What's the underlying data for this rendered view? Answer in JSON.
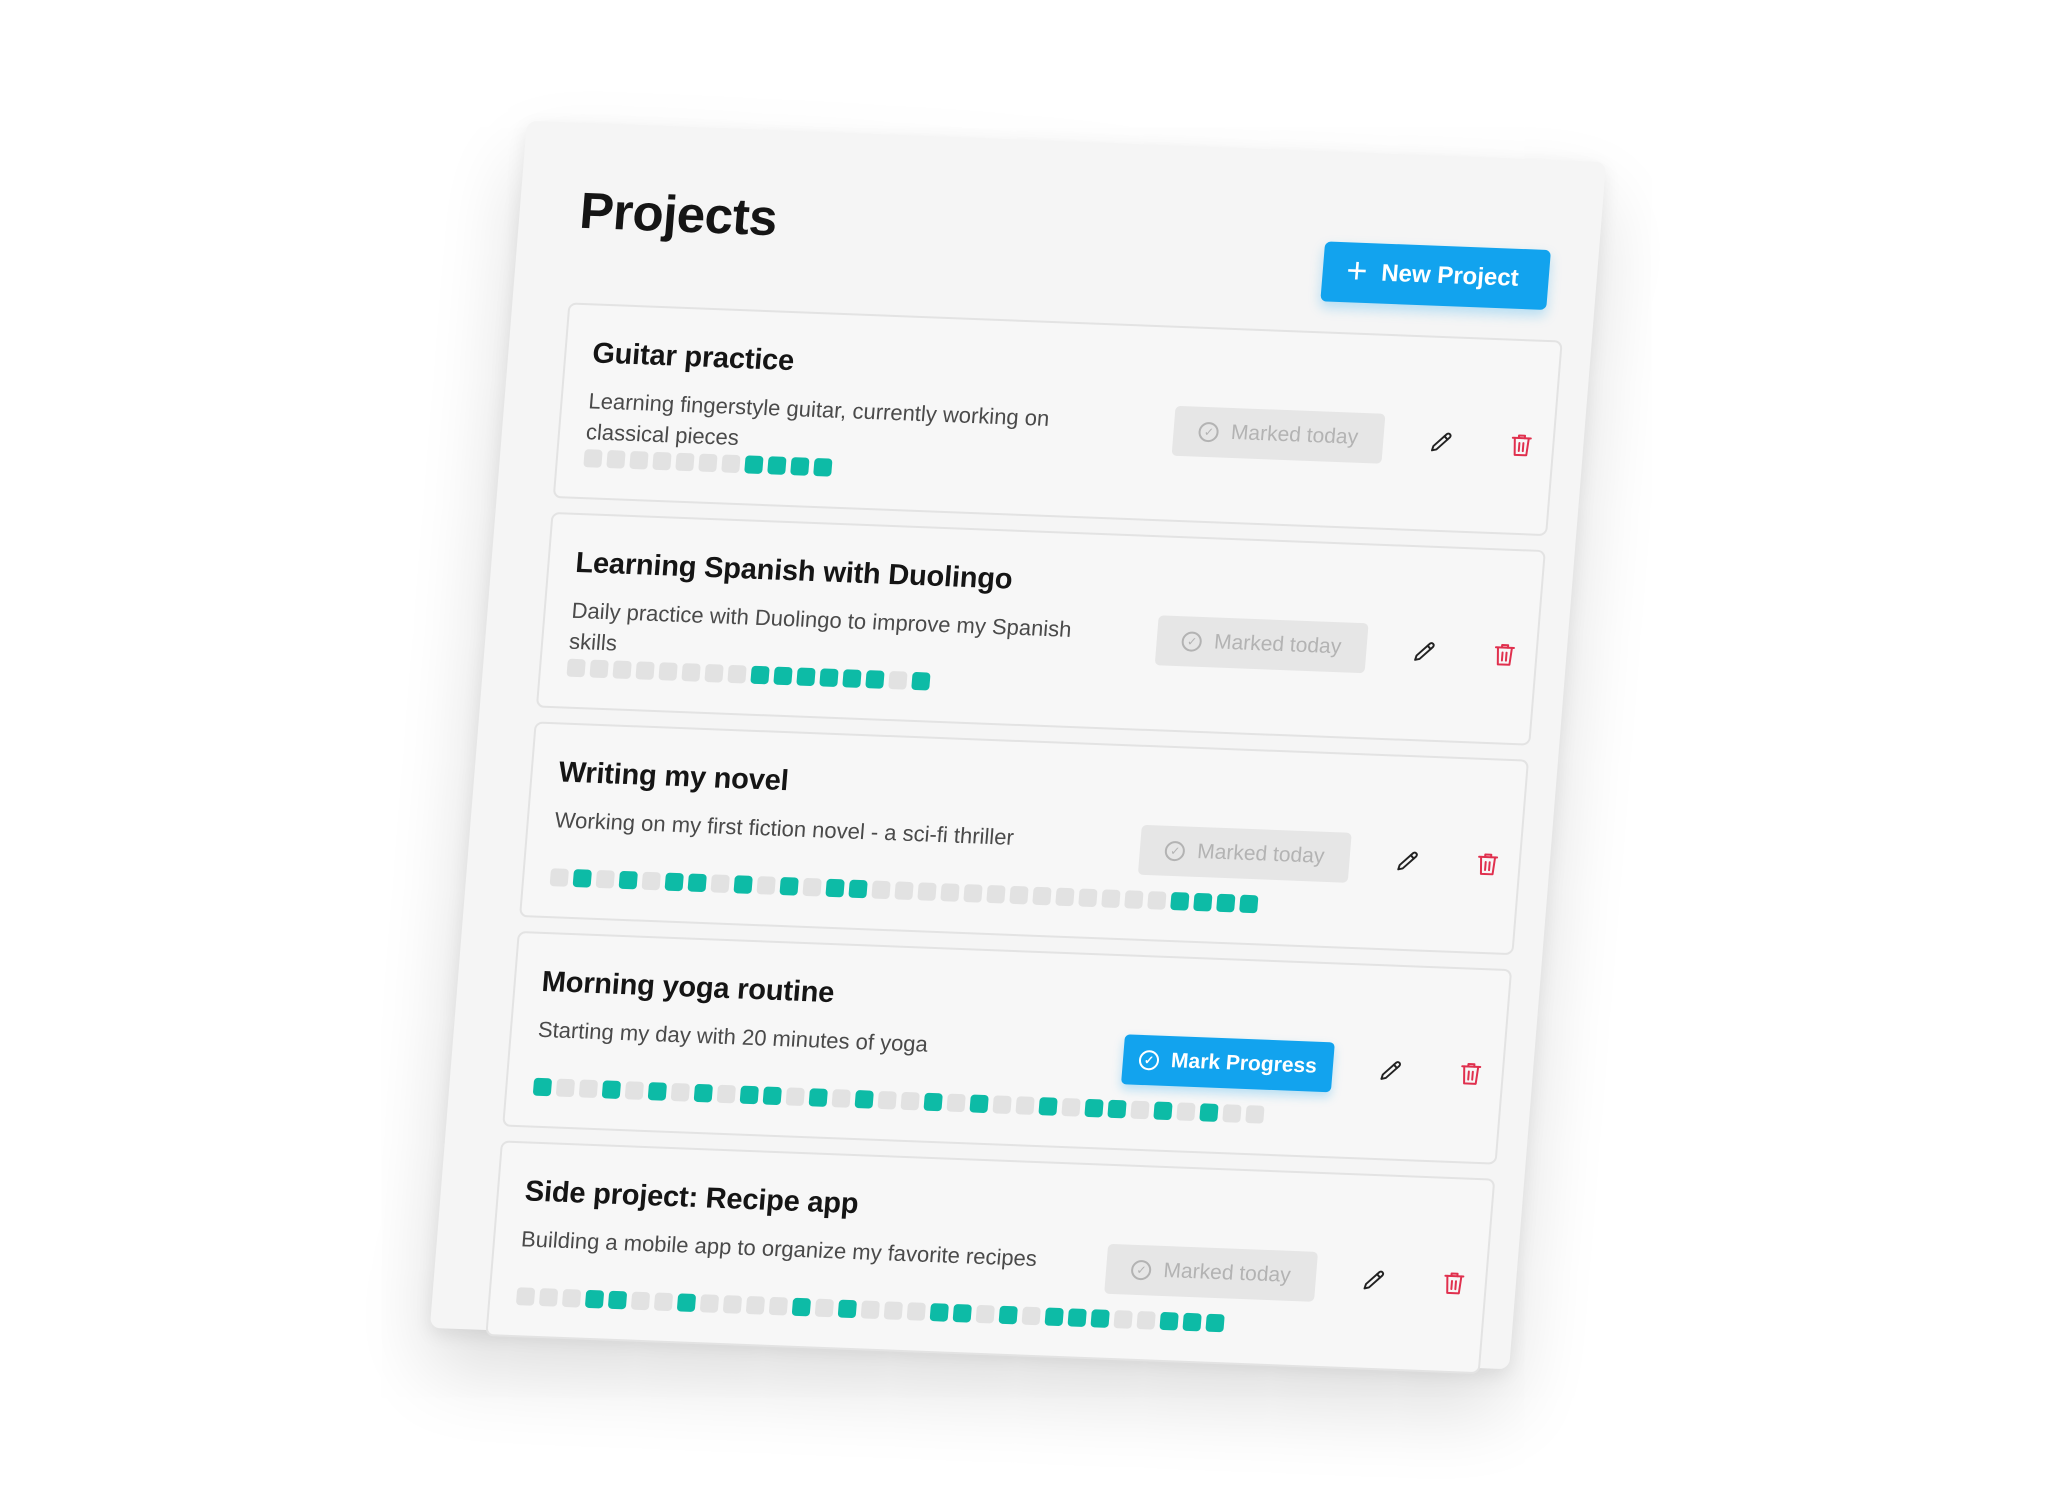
{
  "header": {
    "title": "Projects",
    "new_project_label": "New Project"
  },
  "colors": {
    "accent": "#12a3ee",
    "streak_done": "#0dbba6",
    "streak_empty": "#e2e2e2",
    "delete": "#e0304e"
  },
  "projects": [
    {
      "title": "Guitar practice",
      "description": "Learning fingerstyle guitar, currently working on classical pieces",
      "status_label": "Marked today",
      "status_state": "marked",
      "streak": [
        0,
        0,
        0,
        0,
        0,
        0,
        0,
        1,
        1,
        1,
        1
      ]
    },
    {
      "title": "Learning Spanish with Duolingo",
      "description": "Daily practice with Duolingo to improve my Spanish skills",
      "status_label": "Marked today",
      "status_state": "marked",
      "streak": [
        0,
        0,
        0,
        0,
        0,
        0,
        0,
        0,
        1,
        1,
        1,
        1,
        1,
        1,
        0,
        1
      ]
    },
    {
      "title": "Writing my novel",
      "description": "Working on my first fiction novel - a sci-fi thriller",
      "status_label": "Marked today",
      "status_state": "marked",
      "streak": [
        0,
        1,
        0,
        1,
        0,
        1,
        1,
        0,
        1,
        0,
        1,
        0,
        1,
        1,
        0,
        0,
        0,
        0,
        0,
        0,
        0,
        0,
        0,
        0,
        0,
        0,
        0,
        1,
        1,
        1,
        1
      ]
    },
    {
      "title": "Morning yoga routine",
      "description": "Starting my day with 20 minutes of yoga",
      "status_label": "Mark Progress",
      "status_state": "pending",
      "streak": [
        1,
        0,
        0,
        1,
        0,
        1,
        0,
        1,
        0,
        1,
        1,
        0,
        1,
        0,
        1,
        0,
        0,
        1,
        0,
        1,
        0,
        0,
        1,
        0,
        1,
        1,
        0,
        1,
        0,
        1,
        0,
        0
      ]
    },
    {
      "title": "Side project: Recipe app",
      "description": "Building a mobile app to organize my favorite recipes",
      "status_label": "Marked today",
      "status_state": "marked",
      "streak": [
        0,
        0,
        0,
        1,
        1,
        0,
        0,
        1,
        0,
        0,
        0,
        0,
        1,
        0,
        1,
        0,
        0,
        0,
        1,
        1,
        0,
        1,
        0,
        1,
        1,
        1,
        0,
        0,
        1,
        1,
        1
      ]
    }
  ]
}
